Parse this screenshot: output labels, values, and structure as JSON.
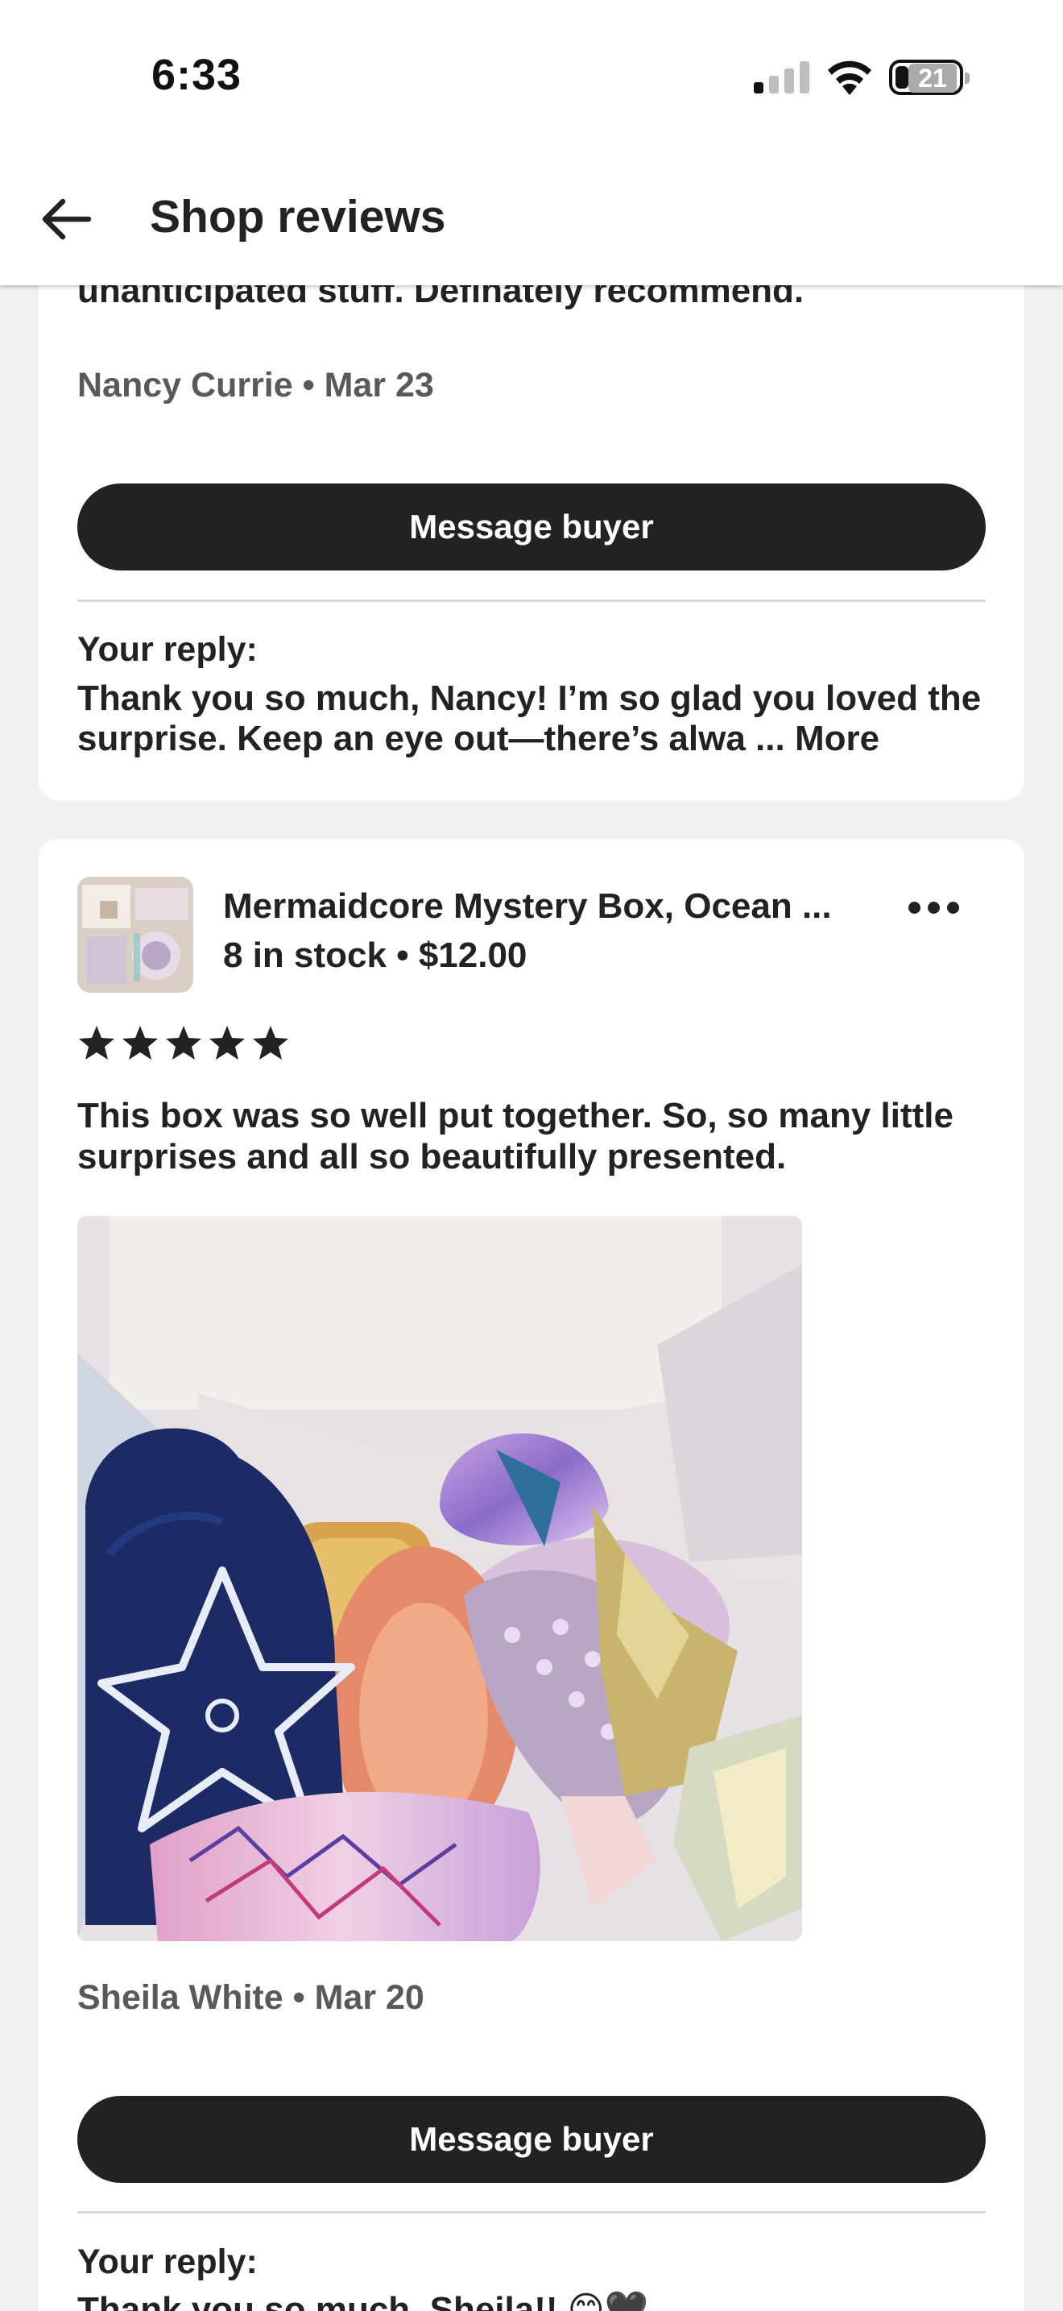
{
  "status_bar": {
    "time": "6:33",
    "battery_level": "21"
  },
  "header": {
    "title": "Shop reviews",
    "back_icon": "arrow-left-icon"
  },
  "reviews": [
    {
      "clipped_text": "unanticipated stuff. Definately recommend.",
      "reviewer": "Nancy Currie",
      "date": "Mar 23",
      "reviewer_date": "Nancy Currie • Mar 23",
      "message_button": "Message buyer",
      "reply_label": "Your reply:",
      "reply_text": "Thank you so much, Nancy! I’m so glad you loved the surprise. Keep an eye out—there’s alwa ...",
      "reply_more": "More"
    },
    {
      "listing_title": "Mermaidcore Mystery Box, Ocean ...",
      "listing_meta": "8 in stock • $12.00",
      "rating": 5,
      "review_text": "This box was so well put together.  So, so many little surprises and all so beautifully presented.",
      "reviewer": "Sheila White",
      "date": "Mar 20",
      "reviewer_date": "Sheila White • Mar 20",
      "message_button": "Message buyer",
      "reply_label": "Your reply:",
      "reply_text": "Thank you so much, Sheila!! 😊🖤"
    }
  ],
  "colors": {
    "background": "#f1f1f1",
    "card": "#ffffff",
    "button": "#222222",
    "text": "#222222",
    "muted_text": "#595959"
  }
}
